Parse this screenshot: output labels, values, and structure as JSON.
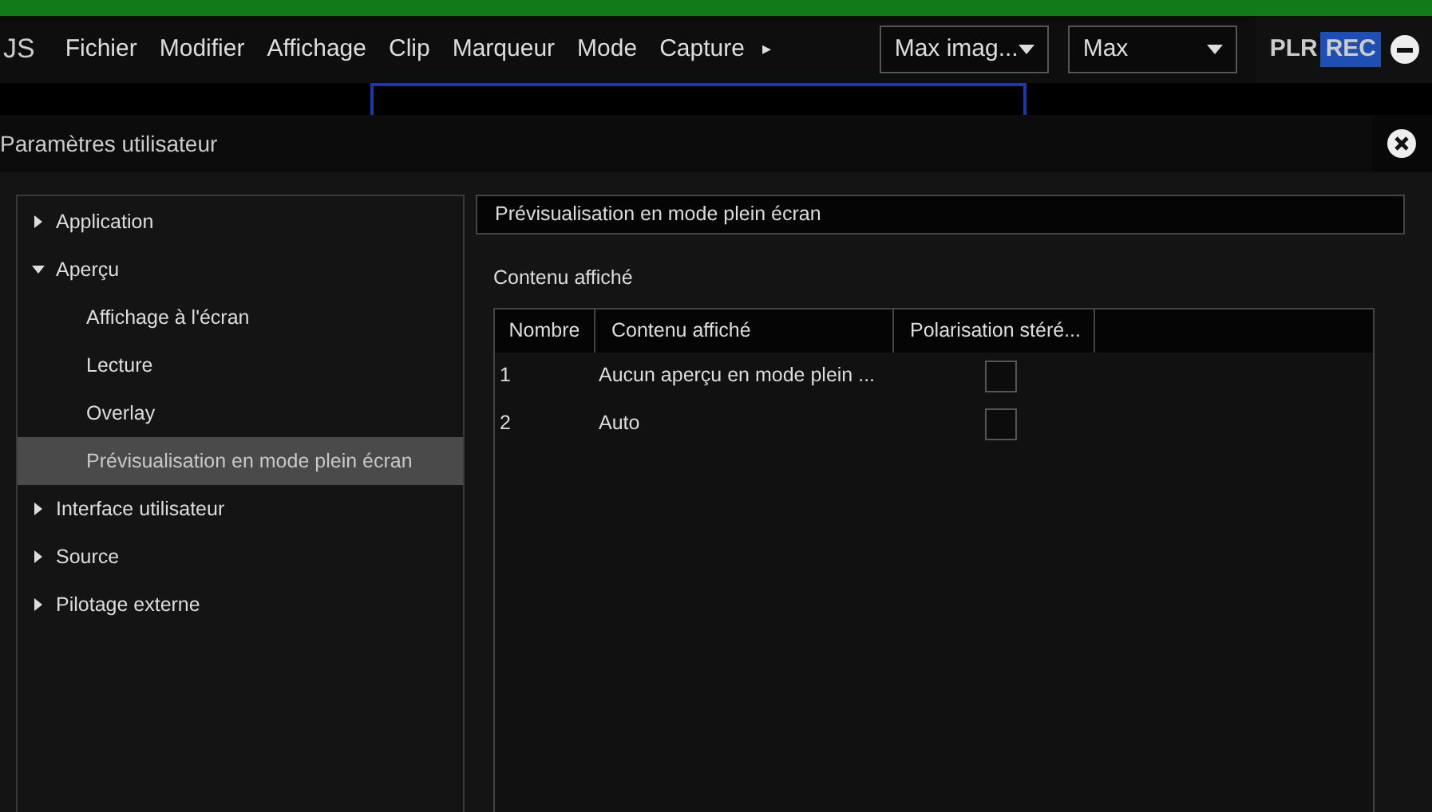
{
  "menu_bar": {
    "logo_text": "JS",
    "items": [
      "Fichier",
      "Modifier",
      "Affichage",
      "Clip",
      "Marqueur",
      "Mode",
      "Capture"
    ],
    "more": "▸",
    "dropdowns": [
      "Max imag...",
      "Max"
    ],
    "plr": "PLR",
    "rec": "REC"
  },
  "dialog": {
    "title": "Paramètres utilisateur",
    "tree": [
      {
        "label": "Application",
        "expanded": false,
        "selected": false
      },
      {
        "label": "Aperçu",
        "expanded": true,
        "selected": false,
        "children": [
          {
            "label": "Affichage à l'écran",
            "selected": false
          },
          {
            "label": "Lecture",
            "selected": false
          },
          {
            "label": "Overlay",
            "selected": false
          },
          {
            "label": "Prévisualisation en mode plein écran",
            "selected": true
          }
        ]
      },
      {
        "label": "Interface utilisateur",
        "expanded": false,
        "selected": false
      },
      {
        "label": "Source",
        "expanded": false,
        "selected": false
      },
      {
        "label": "Pilotage externe",
        "expanded": false,
        "selected": false
      }
    ],
    "section_title": "Prévisualisation en mode plein écran",
    "group_label": "Contenu affiché",
    "table": {
      "columns": [
        "Nombre",
        "Contenu affiché",
        "Polarisation stéré..."
      ],
      "rows": [
        {
          "number": "1",
          "content": "Aucun aperçu en mode plein ...",
          "checked": false
        },
        {
          "number": "2",
          "content": "Auto",
          "checked": false
        }
      ]
    }
  }
}
